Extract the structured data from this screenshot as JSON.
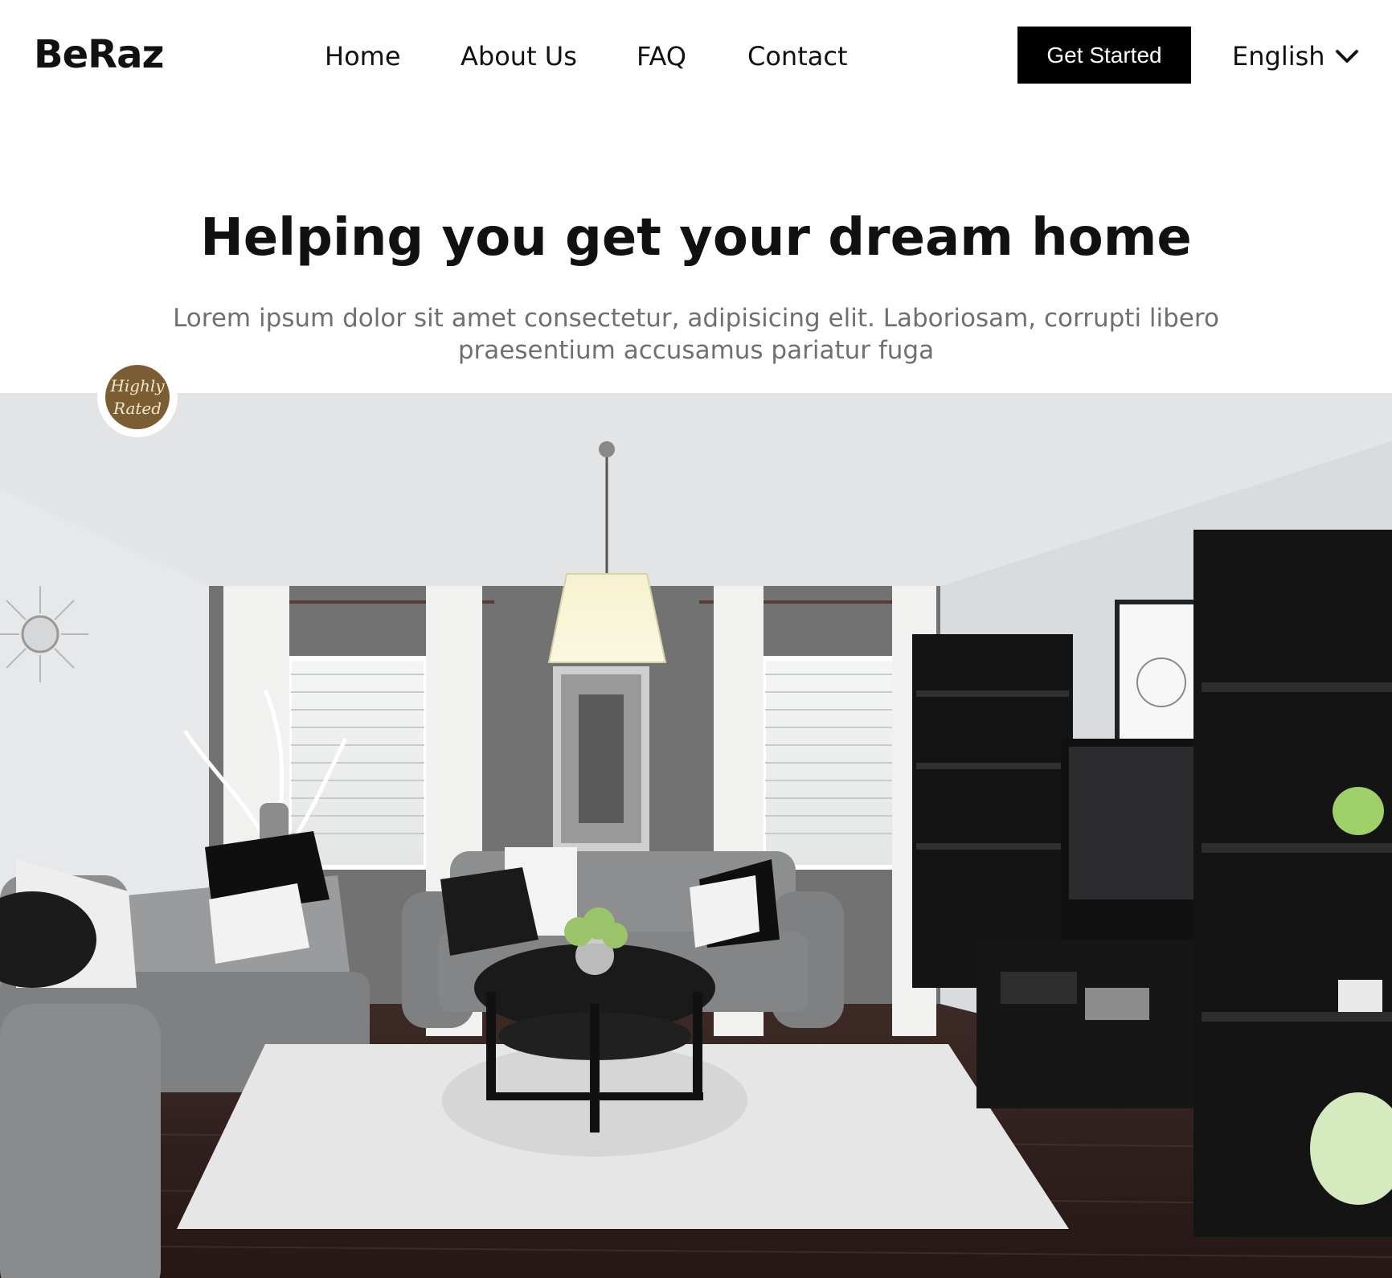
{
  "brand": {
    "name": "BeRaz"
  },
  "nav": {
    "items": [
      {
        "label": "Home"
      },
      {
        "label": "About Us"
      },
      {
        "label": "FAQ"
      },
      {
        "label": "Contact"
      }
    ],
    "cta_label": "Get Started",
    "language": {
      "selected": "English",
      "icon": "chevron-down-icon"
    }
  },
  "hero": {
    "title": "Helping you get your dream home",
    "subtitle": "Lorem ipsum dolor sit amet consectetur, adipisicing elit. Laboriosam, corrupti libero praesentium accusamus pariatur fuga",
    "badge": {
      "line1": "Highly",
      "line2": "Rated",
      "color": "#7a5d32"
    }
  },
  "colors": {
    "cta_background": "#000000",
    "cta_text": "#ffffff",
    "subtitle_text": "#6f6f6f"
  }
}
